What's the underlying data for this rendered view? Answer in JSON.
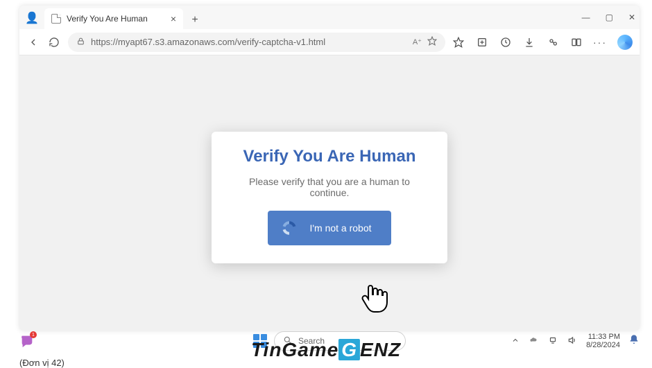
{
  "window": {
    "tab_title": "Verify You Are Human",
    "minimize_glyph": "—",
    "maximize_glyph": "▢",
    "close_glyph": "✕"
  },
  "toolbar": {
    "url": "https://myapt67.s3.amazonaws.com/verify-captcha-v1.html",
    "icons": {
      "back_label": "back",
      "refresh_label": "refresh",
      "site_info_label": "site-info",
      "read_aloud_label": "read-aloud",
      "star_label": "favorite-star",
      "favorites_label": "favorites",
      "collections_label": "collections",
      "history_label": "history",
      "download_label": "downloads",
      "extensions_label": "extensions",
      "split_label": "split-screen",
      "more_label": "more",
      "copilot_label": "copilot"
    }
  },
  "captcha": {
    "heading": "Verify You Are Human",
    "subtext": "Please verify that you are a human to continue.",
    "button_label": "I'm not a robot"
  },
  "taskbar": {
    "teams_badge_count": "1",
    "search_placeholder": "Search",
    "time": "11:33 PM",
    "date": "8/28/2024"
  },
  "watermark": {
    "part1": "TinGame",
    "part2": "G",
    "part3": "ENZ"
  },
  "footer_note": "(Đơn vị 42)"
}
